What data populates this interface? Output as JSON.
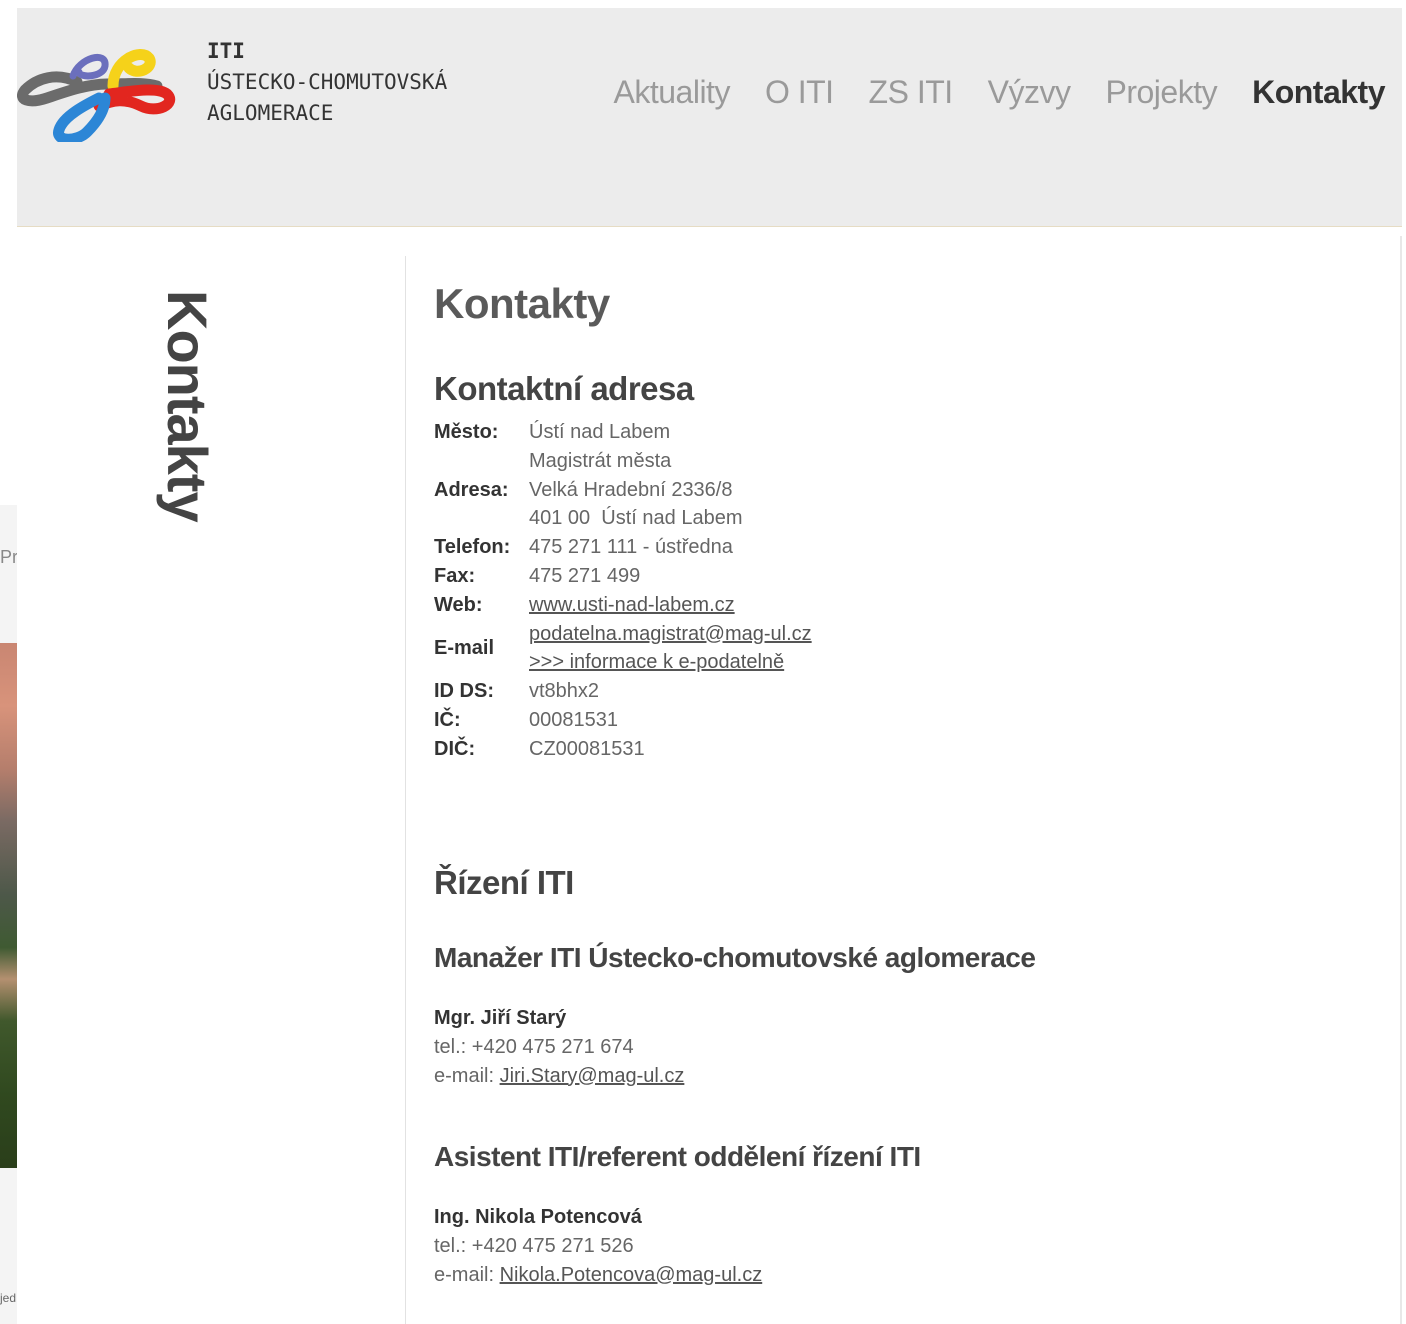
{
  "background": {
    "text_fragment": "Pr",
    "footer_fragment": "jed"
  },
  "header": {
    "logo": {
      "line1": "ITI",
      "line2": "ÚSTECKO-CHOMUTOVSKÁ",
      "line3": "AGLOMERACE",
      "colors": [
        "#f5d21a",
        "#e2261f",
        "#2c86d6",
        "#6b6fbd",
        "#6b6b6b"
      ]
    },
    "nav": [
      {
        "label": "Aktuality",
        "active": false
      },
      {
        "label": "O ITI",
        "active": false
      },
      {
        "label": "ZS ITI",
        "active": false
      },
      {
        "label": "Výzvy",
        "active": false
      },
      {
        "label": "Projekty",
        "active": false
      },
      {
        "label": "Kontakty",
        "active": true
      }
    ]
  },
  "sidebar": {
    "vertical_title": "Kontakty"
  },
  "main": {
    "title": "Kontakty",
    "address_section": {
      "heading": "Kontaktní adresa",
      "rows": {
        "mesto": {
          "key": "Město:",
          "value1": "Ústí nad Labem",
          "value2": "Magistrát města"
        },
        "adresa": {
          "key": "Adresa:",
          "value1": "Velká Hradební 2336/8",
          "value2": "401 00  Ústí nad Labem"
        },
        "telefon": {
          "key": "Telefon:",
          "value": "475 271 111 - ústředna"
        },
        "fax": {
          "key": "Fax:",
          "value": "475 271 499"
        },
        "web": {
          "key": "Web:",
          "value": "www.usti-nad-labem.cz"
        },
        "email": {
          "key": "E-mail",
          "value": "podatelna.magistrat@mag-ul.cz",
          "link2": ">>> informace k e-podatelně"
        },
        "idds": {
          "key": "ID DS:",
          "value": "vt8bhx2"
        },
        "ic": {
          "key": "IČ:",
          "value": "00081531"
        },
        "dic": {
          "key": "DIČ:",
          "value": "CZ00081531"
        }
      }
    },
    "management": {
      "heading": "Řízení ITI",
      "manager": {
        "role": "Manažer ITI Ústecko-chomutovské aglomerace",
        "name": "Mgr. Jiří Starý",
        "tel": "tel.: +420 475 271 674",
        "email_prefix": "e-mail: ",
        "email": "Jiri.Stary@mag-ul.cz"
      },
      "assistant": {
        "role": "Asistent ITI/referent oddělení řízení ITI",
        "name": "Ing. Nikola Potencová",
        "tel": "tel.: +420 475 271 526",
        "email_prefix": "e-mail: ",
        "email": "Nikola.Potencova@mag-ul.cz"
      }
    }
  }
}
